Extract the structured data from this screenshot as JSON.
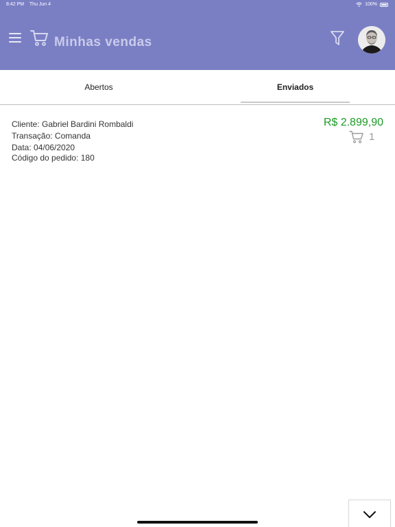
{
  "status_bar": {
    "time": "8:42 PM",
    "date": "Thu Jun 4",
    "battery": "100%"
  },
  "header": {
    "title": "Minhas vendas"
  },
  "icons": {
    "menu": "hamburger-menu-icon",
    "cart": "shopping-cart-icon",
    "filter": "filter-funnel-icon",
    "expand": "chevron-down-icon"
  },
  "colors": {
    "appbar": "#7a7fc4",
    "price": "#1c9a24"
  },
  "tabs": [
    {
      "label": "Abertos",
      "selected": false
    },
    {
      "label": "Enviados",
      "selected": true
    }
  ],
  "orders": [
    {
      "client": "Cliente: Gabriel Bardini Rombaldi",
      "transaction": "Transação: Comanda",
      "date": "Data: 04/06/2020",
      "order_code": "Código do pedido: 180",
      "price": "R$ 2.899,90",
      "item_count": "1"
    }
  ]
}
